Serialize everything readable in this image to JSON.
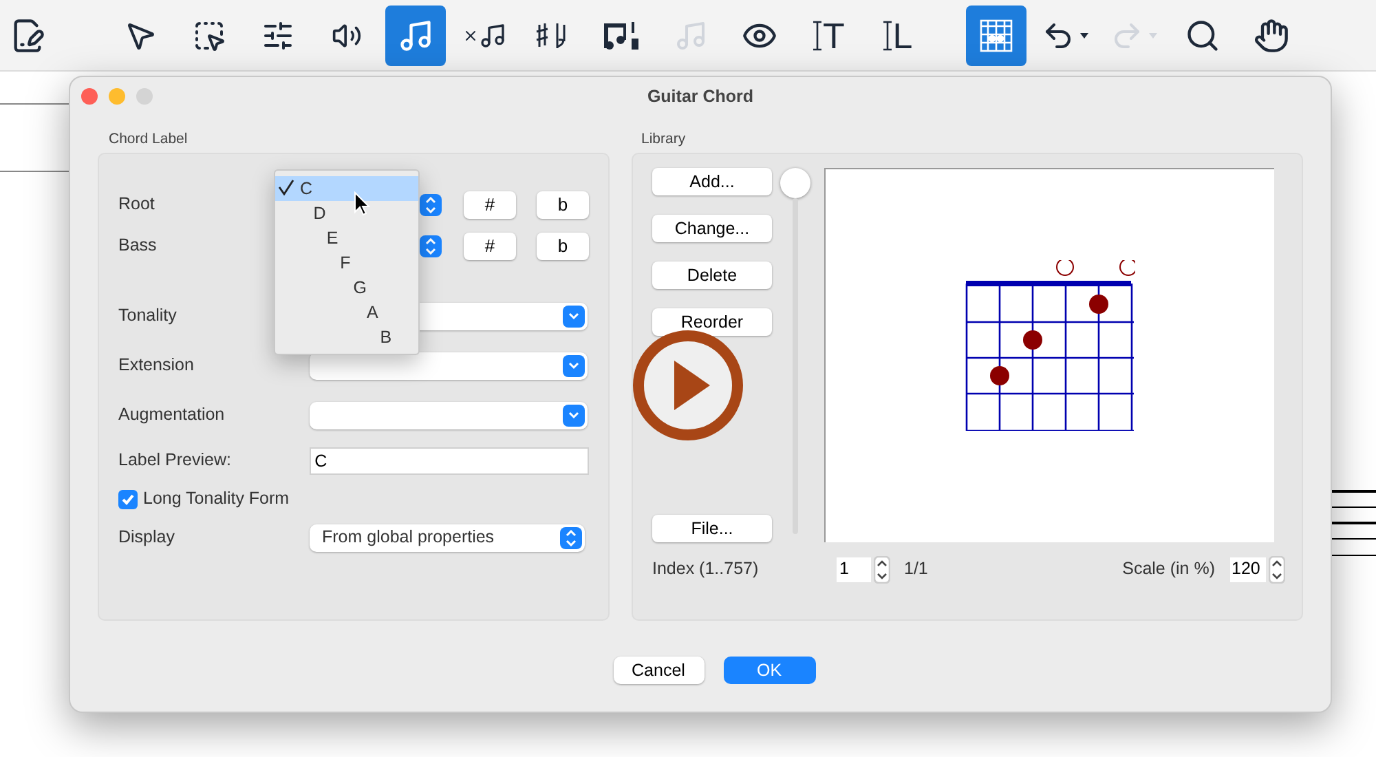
{
  "toolbar": [
    {
      "kind": "document",
      "selected": false,
      "disabled": false
    },
    {
      "kind": "pointer",
      "selected": false,
      "disabled": false
    },
    {
      "kind": "marquee",
      "selected": false,
      "disabled": false
    },
    {
      "kind": "sliders",
      "selected": false,
      "disabled": false
    },
    {
      "kind": "playback",
      "selected": false,
      "disabled": false
    },
    {
      "kind": "note-input",
      "selected": true,
      "disabled": false
    },
    {
      "kind": "note-x",
      "selected": false,
      "disabled": false
    },
    {
      "kind": "accidentals",
      "selected": false,
      "disabled": false
    },
    {
      "kind": "voices",
      "selected": false,
      "disabled": false
    },
    {
      "kind": "note-2",
      "selected": false,
      "disabled": true
    },
    {
      "kind": "eye",
      "selected": false,
      "disabled": false
    },
    {
      "kind": "text",
      "label": "T",
      "selected": false,
      "disabled": false
    },
    {
      "kind": "text",
      "label": "L",
      "selected": false,
      "disabled": false
    },
    {
      "kind": "chord",
      "selected": true,
      "disabled": false
    },
    {
      "kind": "undo",
      "selected": false,
      "disabled": false
    },
    {
      "kind": "redo",
      "selected": false,
      "disabled": true
    },
    {
      "kind": "zoom",
      "selected": false,
      "disabled": false
    },
    {
      "kind": "hand",
      "selected": false,
      "disabled": false
    }
  ],
  "window": {
    "title": "Guitar Chord"
  },
  "chord_label": {
    "title": "Chord Label",
    "root": {
      "label": "Root",
      "sharp": "#",
      "flat": "b"
    },
    "bass": {
      "label": "Bass",
      "sharp": "#",
      "flat": "b"
    },
    "selects": [
      {
        "label": "Tonality"
      },
      {
        "label": "Extension"
      },
      {
        "label": "Augmentation"
      }
    ],
    "preview": {
      "label": "Label Preview:",
      "value": "C"
    },
    "long_form": {
      "label": "Long Tonality Form",
      "checked": true
    },
    "display": {
      "label": "Display",
      "value": "From global properties"
    }
  },
  "root_menu": [
    {
      "label": "C",
      "selected": true
    },
    {
      "label": "D",
      "selected": false
    },
    {
      "label": "E",
      "selected": false
    },
    {
      "label": "F",
      "selected": false
    },
    {
      "label": "G",
      "selected": false
    },
    {
      "label": "A",
      "selected": false
    },
    {
      "label": "B",
      "selected": false
    }
  ],
  "library": {
    "title": "Library",
    "buttons": [
      "Add...",
      "Change...",
      "Delete",
      "Reorder"
    ],
    "file_button": "File...",
    "slider": {
      "level": 1
    },
    "index_label": "Index (1..757)",
    "index_value": "1",
    "count": "1/1",
    "scale_label": "Scale (in %)",
    "scale_value": "120"
  },
  "footer": {
    "cancel": "Cancel",
    "ok": "OK"
  }
}
